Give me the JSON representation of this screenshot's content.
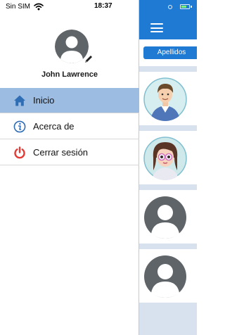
{
  "status_bar": {
    "carrier": "Sin SIM",
    "time": "18:37"
  },
  "profile": {
    "name": "John Lawrence"
  },
  "menu": {
    "items": [
      {
        "label": "Inicio",
        "icon": "home-icon",
        "active": true
      },
      {
        "label": "Acerca de",
        "icon": "info-icon",
        "active": false
      },
      {
        "label": "Cerrar sesión",
        "icon": "power-icon",
        "active": false
      }
    ]
  },
  "background_app": {
    "filter_label": "Apellidos",
    "contacts": [
      {
        "avatar": "male-cartoon-avatar"
      },
      {
        "avatar": "female-cartoon-avatar"
      },
      {
        "avatar": "default-user-avatar"
      },
      {
        "avatar": "default-user-avatar"
      }
    ]
  },
  "colors": {
    "accent": "#1f7ad3",
    "active_item": "#9cbce2",
    "home_icon": "#2f6eb5",
    "info_icon": "#2f6eb5",
    "power_icon": "#e53935"
  }
}
